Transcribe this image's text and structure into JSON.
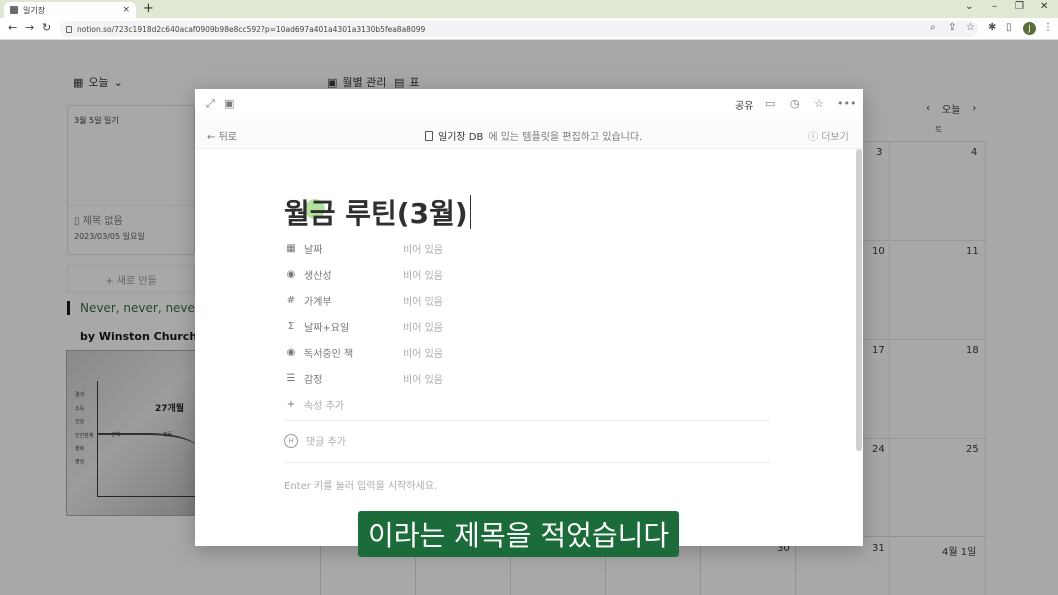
{
  "browser": {
    "tab_title": "일기장",
    "tab_close": "×",
    "new_tab": "+",
    "url": "notion.so/723c1918d2c640acaf0909b98e8cc592?p=10ad697a401a4301a3130b5fea8a8099",
    "profile_initial": "J"
  },
  "background": {
    "view_today": "오늘",
    "view_monthly": "월별 관리",
    "view_table": "표",
    "card_top": "3월 5일 일기",
    "card_title": "제목 없음",
    "card_date": "2023/03/05 일요일",
    "new_button": "+ 새로 만들",
    "quote": "Never, never, never",
    "byline": "by Winston Churchill",
    "photo_title": "27개월",
    "photo_labels": [
      "결과",
      "소득",
      "건강",
      "인간관계",
      "행복",
      "영성"
    ],
    "photo_sublabels": [
      "선택",
      "행동"
    ],
    "calendar": {
      "today_button": "오늘",
      "weekday": "토",
      "nums": [
        "3",
        "4",
        "10",
        "11",
        "17",
        "18",
        "24",
        "25",
        "30",
        "31",
        "4월 1일"
      ]
    }
  },
  "modal": {
    "share": "공유",
    "back": "뒤로",
    "banner_db": "일기장 DB",
    "banner_msg": "에 있는 템플릿을 편집하고 있습니다.",
    "more": "더보기",
    "title": "월금 루틴(3월)",
    "properties": [
      {
        "icon": "▦",
        "name": "날짜",
        "value": "비어 있음"
      },
      {
        "icon": "◉",
        "name": "생산성",
        "value": "비어 있음"
      },
      {
        "icon": "#",
        "name": "가계부",
        "value": "비어 있음"
      },
      {
        "icon": "Σ",
        "name": "날짜+요일",
        "value": "비어 있음"
      },
      {
        "icon": "◉",
        "name": "독서중인 책",
        "value": "비어 있음"
      },
      {
        "icon": "☰",
        "name": "감정",
        "value": "비어 있음"
      }
    ],
    "add_property": "속성 추가",
    "add_comment": "댓글 추가",
    "comment_icon": "H",
    "placeholder": "Enter 키를 눌러 입력을 시작하세요."
  },
  "subtitle": "이라는 제목을 적었습니다"
}
